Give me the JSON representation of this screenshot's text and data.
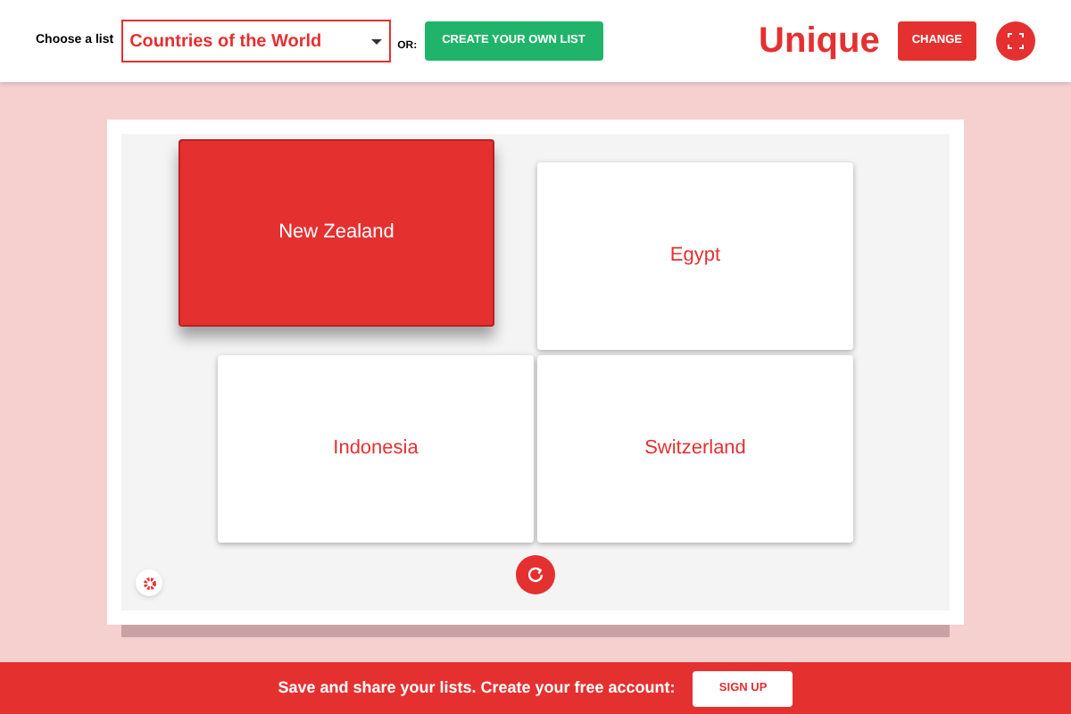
{
  "header": {
    "choose_label": "Choose a list",
    "list_select": {
      "value": "Countries of the World"
    },
    "or_label": "OR:",
    "create_button": "CREATE YOUR OWN LIST",
    "mode_title": "Unique",
    "change_button": "CHANGE"
  },
  "cards": [
    {
      "label": "New Zealand",
      "selected": true
    },
    {
      "label": "Egypt",
      "selected": false
    },
    {
      "label": "Indonesia",
      "selected": false
    },
    {
      "label": "Switzerland",
      "selected": false
    }
  ],
  "footer": {
    "message": "Save and share your lists. Create your free account:",
    "signup_button": "SIGN UP"
  }
}
